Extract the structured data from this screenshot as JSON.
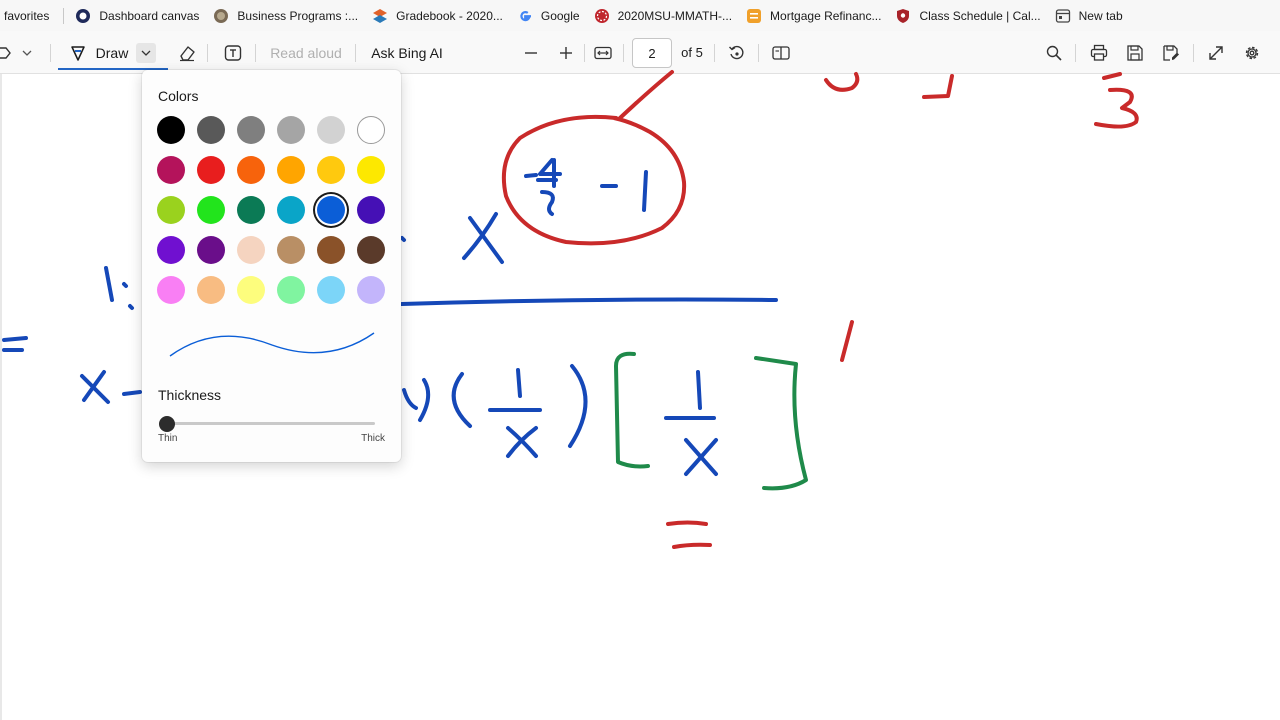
{
  "favorites": {
    "first": "favorites",
    "items": [
      {
        "label": "Dashboard canvas",
        "icon": "canvas-icon",
        "color": "#1f2a5a"
      },
      {
        "label": "Business Programs :...",
        "icon": "school-icon",
        "color": "#7a6a55"
      },
      {
        "label": "Gradebook - 2020...",
        "icon": "gradebook-icon",
        "color": "#e0622a"
      },
      {
        "label": "Google",
        "icon": "google-icon",
        "color": "#4285f4"
      },
      {
        "label": "2020MSU-MMATH-...",
        "icon": "msu-icon",
        "color": "#c0262d"
      },
      {
        "label": "Mortgage Refinanc...",
        "icon": "mortgage-icon",
        "color": "#f0a02a"
      },
      {
        "label": "Class Schedule | Cal...",
        "icon": "shield-icon",
        "color": "#a8232a"
      },
      {
        "label": "New tab",
        "icon": "new-tab-icon",
        "color": "#444444"
      }
    ]
  },
  "toolbar": {
    "draw_label": "Draw",
    "read_aloud_label": "Read aloud",
    "ask_bing_label": "Ask Bing AI",
    "page_number": "2",
    "page_total": "of 5",
    "accent": "#2366c5"
  },
  "flyout": {
    "colors_heading": "Colors",
    "thickness_heading": "Thickness",
    "thin_label": "Thin",
    "thick_label": "Thick",
    "selected_color": "#0b5ed7",
    "thickness_value": 0,
    "colors": [
      [
        "#000000",
        "#595959",
        "#7f7f7f",
        "#a5a5a5",
        "#d2d2d2",
        "#ffffff"
      ],
      [
        "#b4135b",
        "#e81e1e",
        "#f7630c",
        "#ffa500",
        "#ffc90e",
        "#fde800"
      ],
      [
        "#9ad21e",
        "#22e41c",
        "#0b7a55",
        "#0aa5c8",
        "#0b5ed7",
        "#4510b5"
      ],
      [
        "#7010d0",
        "#6a0e8a",
        "#f5d4c0",
        "#b98f65",
        "#8a5229",
        "#5a3a2a"
      ],
      [
        "#f97ff4",
        "#f8bc82",
        "#fdfd7d",
        "#80f4a0",
        "#7cd5f8",
        "#c3b5fb"
      ]
    ]
  },
  "ink_colors": {
    "blue": "#1548b8",
    "red": "#c92a2a",
    "green": "#1f8a4a"
  }
}
